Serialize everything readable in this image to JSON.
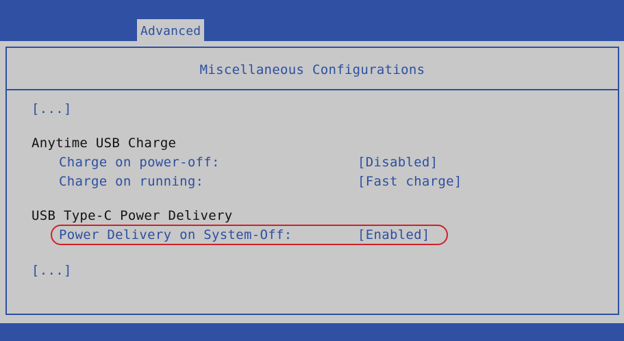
{
  "tabs": {
    "advanced": "Advanced"
  },
  "panel": {
    "title": "Miscellaneous Configurations",
    "ellipsis_top": "[...]",
    "ellipsis_bottom": "[...]"
  },
  "anytime_usb_charge": {
    "heading": "Anytime USB Charge",
    "charge_power_off_label": "Charge on power-off:",
    "charge_power_off_value": "[Disabled]",
    "charge_running_label": "Charge on running:",
    "charge_running_value": "[Fast charge]"
  },
  "usb_type_c": {
    "heading": "USB Type-C Power Delivery",
    "pd_system_off_label": "Power Delivery on System-Off:",
    "pd_system_off_value": "[Enabled]"
  },
  "colors": {
    "background_blue": "#2f50a3",
    "panel_gray": "#c8c8c8",
    "text_blue": "#2d4fa0",
    "highlight_red": "#d0202a"
  }
}
